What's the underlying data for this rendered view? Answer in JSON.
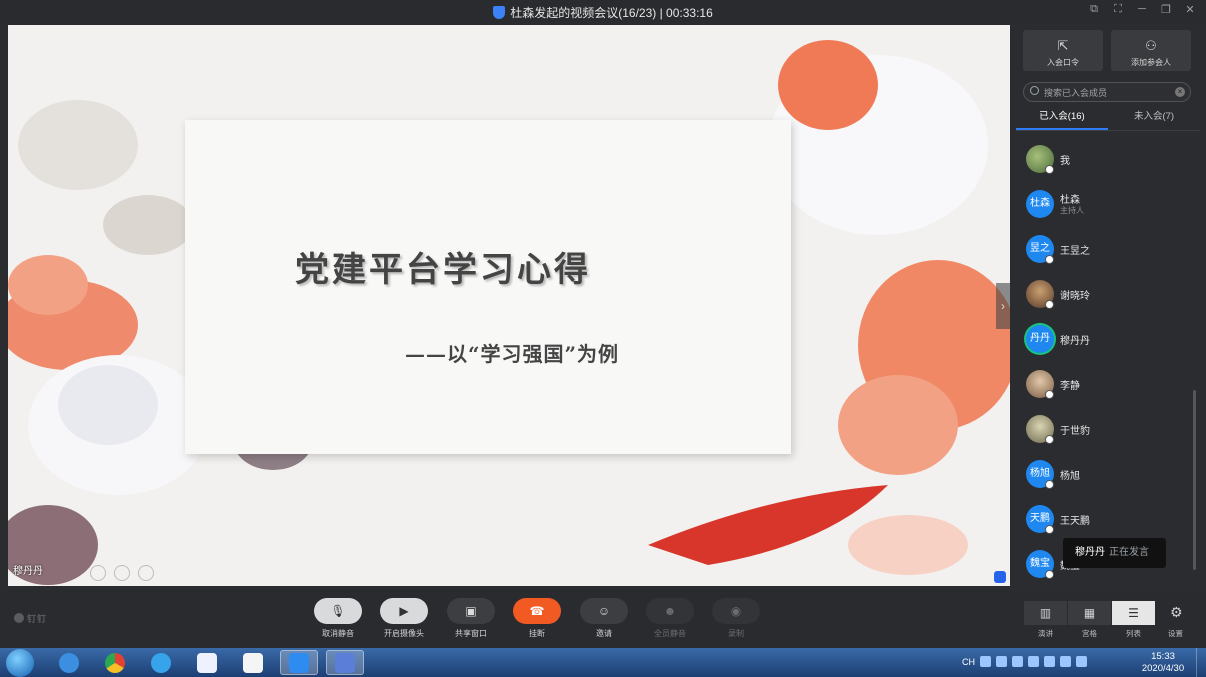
{
  "window": {
    "title": "杜森发起的视频会议(16/23) | 00:33:16"
  },
  "slide": {
    "title": "党建平台学习心得",
    "subtitle": "——以“学习强国”为例",
    "speaker_name": "穆丹丹"
  },
  "sidebar": {
    "join_code_label": "入会口令",
    "add_participant_label": "添加参会人",
    "search_placeholder": "搜索已入会成员",
    "tab_joined": "已入会(16)",
    "tab_not_joined": "未入会(7)",
    "members": [
      {
        "name": "我",
        "avatar_text": "",
        "role": ""
      },
      {
        "name": "杜森",
        "avatar_text": "杜森",
        "role": "主持人"
      },
      {
        "name": "王昱之",
        "avatar_text": "昱之",
        "role": ""
      },
      {
        "name": "谢晓玲",
        "avatar_text": "",
        "role": ""
      },
      {
        "name": "穆丹丹",
        "avatar_text": "丹丹",
        "role": ""
      },
      {
        "name": "李静",
        "avatar_text": "",
        "role": ""
      },
      {
        "name": "于世豹",
        "avatar_text": "",
        "role": ""
      },
      {
        "name": "杨旭",
        "avatar_text": "杨旭",
        "role": ""
      },
      {
        "name": "王天鹏",
        "avatar_text": "天鹏",
        "role": ""
      },
      {
        "name": "魏宝",
        "avatar_text": "魏宝",
        "role": ""
      }
    ],
    "speaking_name": "穆丹丹",
    "speaking_text": "正在发言"
  },
  "toolbar": {
    "brand": "钉钉",
    "unmute_label": "取消静音",
    "camera_label": "开启摄像头",
    "share_label": "共享窗口",
    "hangup_label": "挂断",
    "invite_label": "邀请",
    "mute_all_label": "全员静音",
    "record_label": "录制",
    "view_speaker_label": "演讲",
    "view_grid_label": "宫格",
    "view_list_label": "列表",
    "settings_label": "设置"
  },
  "taskbar": {
    "lang": "CH",
    "time": "15:33",
    "date": "2020/4/30"
  }
}
